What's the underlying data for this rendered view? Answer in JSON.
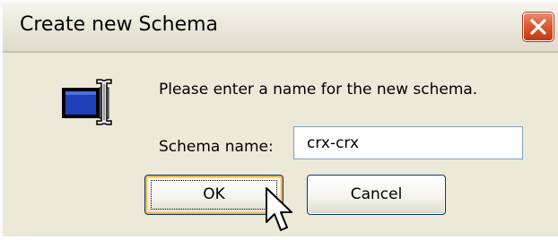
{
  "window": {
    "title": "Create new Schema",
    "close_icon": "close-icon",
    "accent_color": "#d9582f"
  },
  "dialog": {
    "icon": "schema-textfield-icon",
    "prompt": "Please enter a name for the new schema.",
    "field_label": "Schema name:",
    "field_value": "crx-crx"
  },
  "buttons": {
    "ok_label": "OK",
    "cancel_label": "Cancel"
  }
}
